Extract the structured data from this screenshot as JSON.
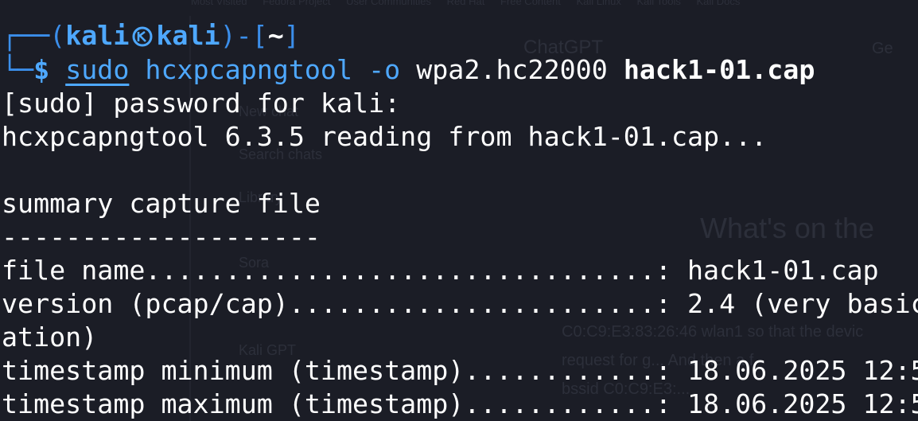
{
  "background_ui": {
    "bookmarks": [
      "Most Visited",
      "Fedora Project",
      "User Communities",
      "Red Hat",
      "Free Content",
      "Kali Linux",
      "Kali Tools",
      "Kali Docs"
    ],
    "title": "ChatGPT",
    "get_button": "Ge",
    "sidebar_items": [
      "New chat",
      "Search chats",
      "Library",
      "Sora",
      "Kali GPT"
    ],
    "heading": "What's on the",
    "text_lines": [
      "C0:C9:E3:83:26:46 wlan1  so that the devic",
      "request for g... And then a f",
      "bssid C0:C9:E3:..."
    ]
  },
  "prompt": {
    "user": "kali",
    "host": "kali",
    "path": "~",
    "symbol": "$"
  },
  "command": {
    "sudo": "sudo",
    "tool": "hcxpcapngtool",
    "flag": "-o",
    "output": "wpa2.hc22000",
    "input": "hack1-01.cap"
  },
  "output_lines": [
    "[sudo] password for kali:",
    "hcxpcapngtool 6.3.5 reading from hack1-01.cap...",
    "",
    "summary capture file",
    "--------------------",
    "file name................................: hack1-01.cap",
    "version (pcap/cap).......................: 2.4 (very basic",
    "ation)",
    "timestamp minimum (timestamp)............: 18.06.2025 12:5",
    "timestamp maximum (timestamp)............: 18.06.2025 12:5"
  ],
  "colors": {
    "background": "#1b1d26",
    "prompt_box": "#3b8eea",
    "accent_blue": "#4ea8ff",
    "text": "#ffffff"
  }
}
